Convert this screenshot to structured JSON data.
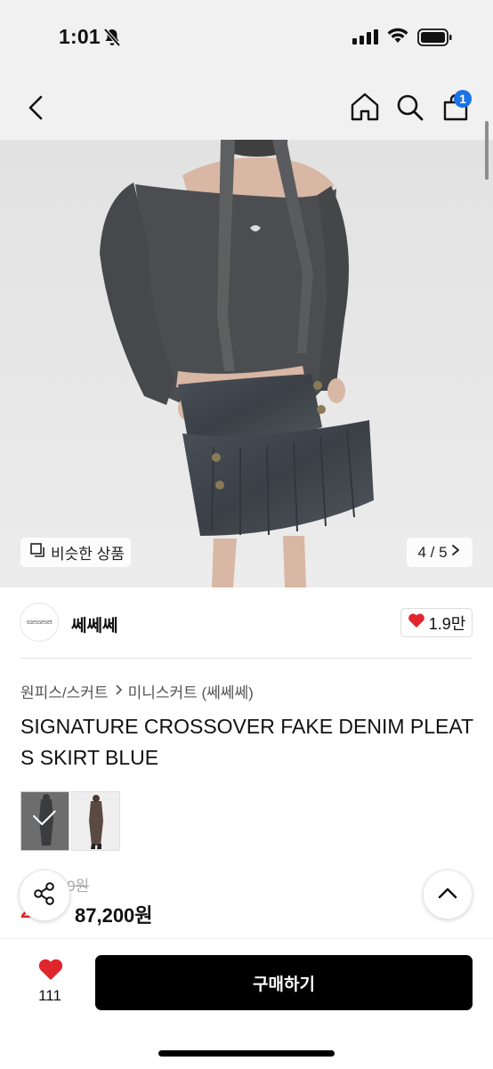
{
  "status_bar": {
    "time": "1:01"
  },
  "nav": {
    "cart_count": "1"
  },
  "image": {
    "similar_label": "비슷한 상품",
    "counter": "4 / 5"
  },
  "brand": {
    "logo_text": "ssesseset",
    "name": "쎄쎄쎄",
    "likes": "1.9만"
  },
  "breadcrumb": {
    "category": "원피스/스커트",
    "sub_category": "미니스커트 (쎄쎄쎄)"
  },
  "product": {
    "title": "SIGNATURE CROSSOVER FAKE DENIM PLEATS SKIRT BLUE",
    "original_price": "109,000원",
    "discount": "20%",
    "price": "87,200원"
  },
  "bottom_bar": {
    "wish_count": "111",
    "buy_label": "구매하기"
  },
  "colors": {
    "accent_red": "#e0262d",
    "badge_blue": "#1a73e8",
    "buy_button": "#000000"
  }
}
